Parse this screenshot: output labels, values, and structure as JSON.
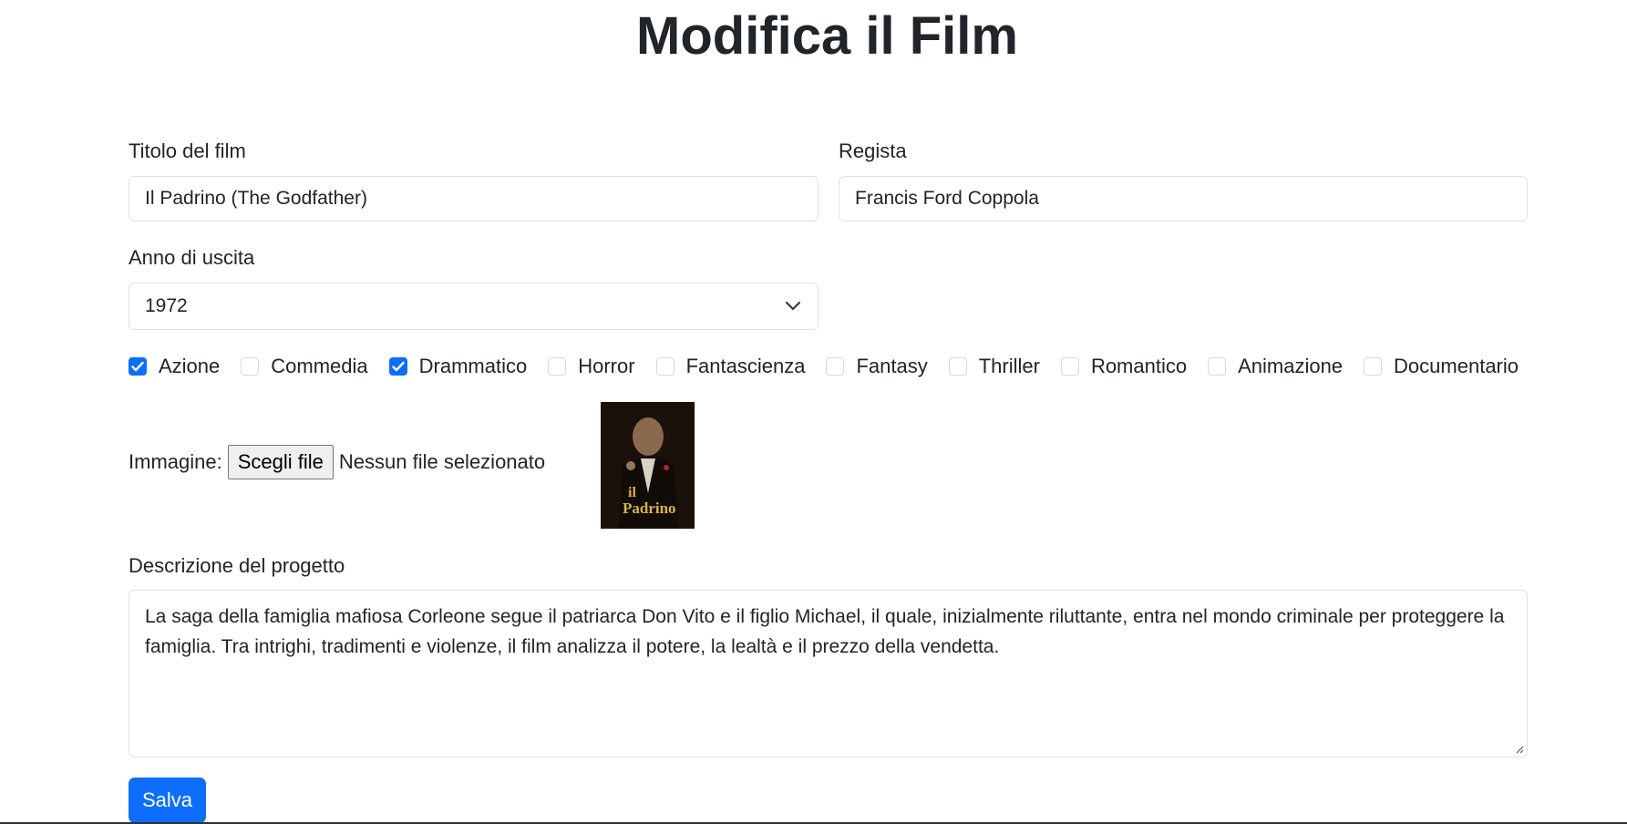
{
  "page": {
    "title": "Modifica il Film"
  },
  "form": {
    "title_label": "Titolo del film",
    "title_value": "Il Padrino (The Godfather)",
    "director_label": "Regista",
    "director_value": "Francis Ford Coppola",
    "year_label": "Anno di uscita",
    "year_value": "1972",
    "genres": [
      {
        "label": "Azione",
        "checked": true
      },
      {
        "label": "Commedia",
        "checked": false
      },
      {
        "label": "Drammatico",
        "checked": true
      },
      {
        "label": "Horror",
        "checked": false
      },
      {
        "label": "Fantascienza",
        "checked": false
      },
      {
        "label": "Fantasy",
        "checked": false
      },
      {
        "label": "Thriller",
        "checked": false
      },
      {
        "label": "Romantico",
        "checked": false
      },
      {
        "label": "Animazione",
        "checked": false
      },
      {
        "label": "Documentario",
        "checked": false
      }
    ],
    "image_label": "Immagine:",
    "file_button": "Scegli file",
    "file_status": "Nessun file selezionato",
    "poster_text": "il Padrino",
    "description_label": "Descrizione del progetto",
    "description_value": "La saga della famiglia mafiosa Corleone segue il patriarca Don Vito e il figlio Michael, il quale, inizialmente riluttante, entra nel mondo criminale per proteggere la famiglia. Tra intrighi, tradimenti e violenze, il film analizza il potere, la lealtà e il prezzo della vendetta.",
    "save_label": "Salva"
  },
  "colors": {
    "accent": "#0d6efd",
    "border": "#dee2e6",
    "text": "#212529"
  },
  "icons": {
    "select": "chevron-down-icon",
    "checkbox": "checkmark-icon"
  }
}
